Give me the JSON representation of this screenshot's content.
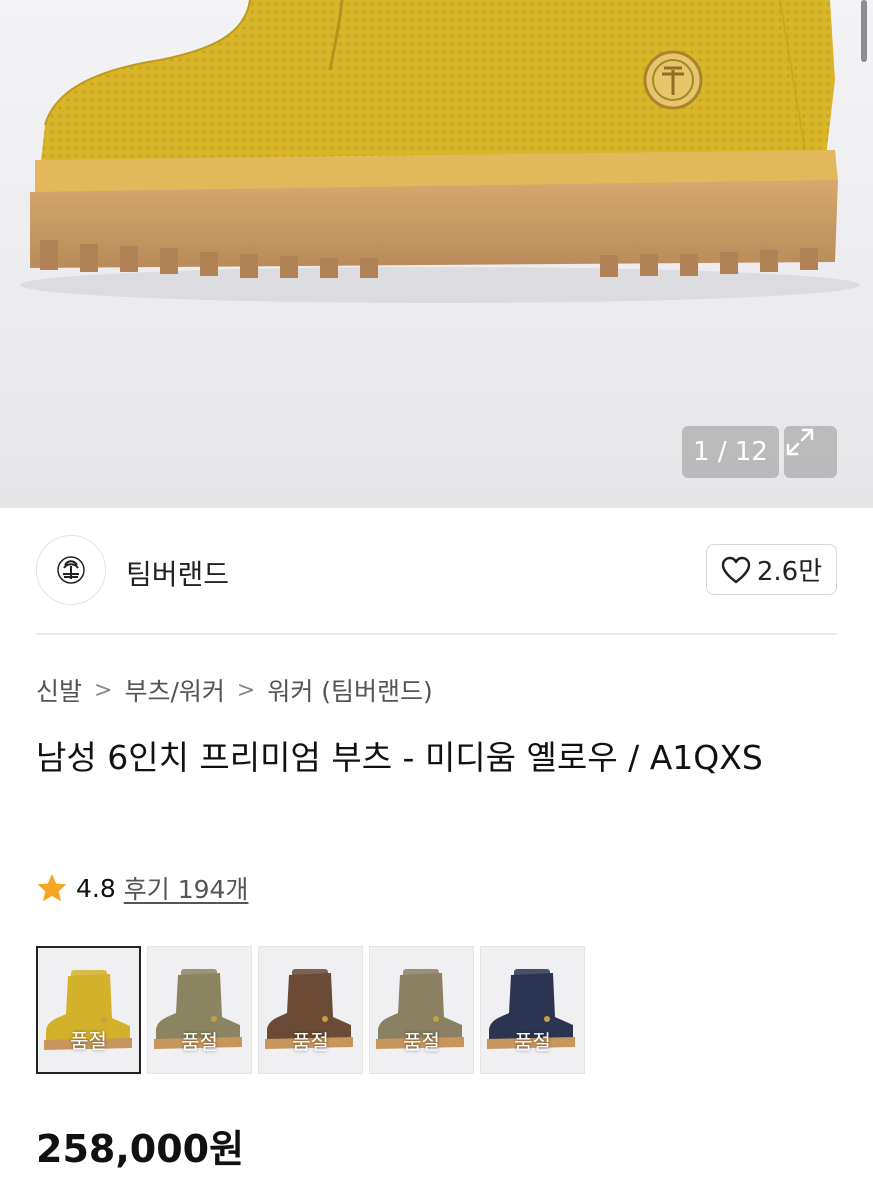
{
  "gallery": {
    "counter": "1 / 12",
    "expand_icon": "expand-icon"
  },
  "brand": {
    "name": "팀버랜드",
    "logo_icon": "tree-logo-icon",
    "like_count": "2.6만",
    "like_icon": "heart-icon"
  },
  "breadcrumb": [
    "신발",
    "부츠/워커",
    "워커 (팀버랜드)"
  ],
  "product": {
    "title": "남성 6인치 프리미엄 부츠 - 미디움 옐로우 / A1QXS",
    "rating": "4.8",
    "reviews": "후기 194개",
    "price": "258,000원"
  },
  "colors": {
    "star": "#F5A623",
    "boot_yellow": "#D9B529"
  },
  "variants": [
    {
      "badge": "품절",
      "color": "#D4B12A",
      "selected": true
    },
    {
      "badge": "품절",
      "color": "#8A8560",
      "selected": false
    },
    {
      "badge": "품절",
      "color": "#6B4A36",
      "selected": false
    },
    {
      "badge": "품절",
      "color": "#8A8062",
      "selected": false
    },
    {
      "badge": "품절",
      "color": "#2B3552",
      "selected": false
    }
  ]
}
